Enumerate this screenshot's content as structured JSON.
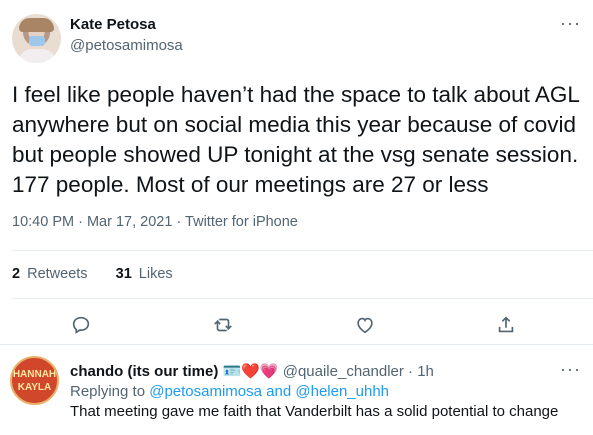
{
  "tweet": {
    "author_name": "Kate Petosa",
    "author_handle": "@petosamimosa",
    "text": "I feel like people haven’t had the space to talk about AGL anywhere but on social media this year because of covid but people showed UP tonight at the vsg senate session. 177 people. Most of our meetings are 27 or less",
    "time": "10:40 PM",
    "date": "Mar 17, 2021",
    "source": "Twitter for iPhone",
    "separator": " · ",
    "retweets_count": "2",
    "retweets_label": "Retweets",
    "likes_count": "31",
    "likes_label": "Likes",
    "more_glyph": "···",
    "icons": [
      "comment-icon",
      "retweet-icon",
      "like-icon",
      "share-icon"
    ]
  },
  "reply": {
    "author_name": "chando (its our time)",
    "emoji": "🪪❤️💗",
    "author_handle": "@quaile_chandler",
    "age": "1h",
    "replying_prefix": "Replying to",
    "mention1": "@petosamimosa",
    "and": "and",
    "mention2": "@helen_uhhh",
    "text": "That meeting gave me faith that Vanderbilt has a solid potential to change",
    "avatar_text": "HANNAH KAYLA",
    "more_glyph": "···"
  },
  "colors": {
    "text": "#0f1419",
    "secondary": "#536471",
    "link": "#1d9bf0",
    "divider": "#e6ecf0"
  }
}
